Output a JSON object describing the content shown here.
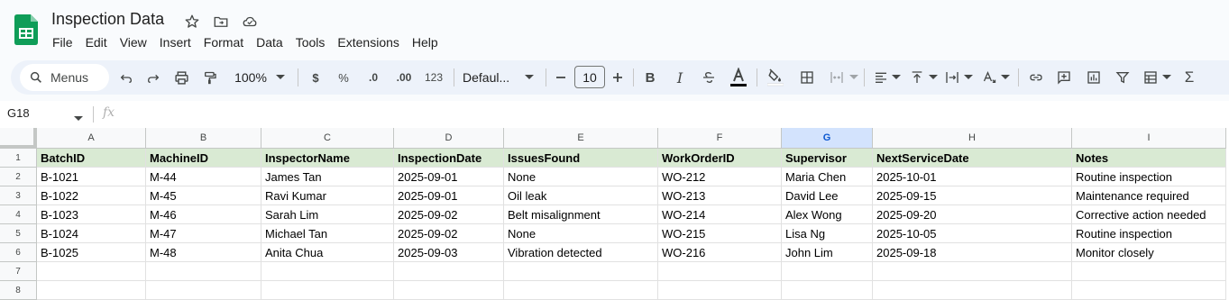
{
  "app": {
    "title": "Inspection Data",
    "menus": [
      "File",
      "Edit",
      "View",
      "Insert",
      "Format",
      "Data",
      "Tools",
      "Extensions",
      "Help"
    ]
  },
  "toolbar": {
    "search_label": "Menus",
    "zoom": "100%",
    "currency": "$",
    "percent": "%",
    "dec_decrease": ".0",
    "dec_increase": ".00",
    "number_format": "123",
    "font": "Defaul...",
    "font_size": "10",
    "accent": "#0b57d0"
  },
  "formula_bar": {
    "name_box": "G18",
    "fx": "fx",
    "value": ""
  },
  "sheet": {
    "columns": [
      "A",
      "B",
      "C",
      "D",
      "E",
      "F",
      "G",
      "H",
      "I"
    ],
    "selected_column": "G",
    "row_numbers": [
      "1",
      "2",
      "3",
      "4",
      "5",
      "6",
      "7",
      "8"
    ],
    "rows": [
      [
        "BatchID",
        "MachineID",
        "InspectorName",
        "InspectionDate",
        "IssuesFound",
        "WorkOrderID",
        "Supervisor",
        "NextServiceDate",
        "Notes"
      ],
      [
        "B-1021",
        "M-44",
        "James Tan",
        "2025-09-01",
        "None",
        "WO-212",
        "Maria Chen",
        "2025-10-01",
        "Routine inspection"
      ],
      [
        "B-1022",
        "M-45",
        "Ravi Kumar",
        "2025-09-01",
        "Oil leak",
        "WO-213",
        "David Lee",
        "2025-09-15",
        "Maintenance required"
      ],
      [
        "B-1023",
        "M-46",
        "Sarah Lim",
        "2025-09-02",
        "Belt misalignment",
        "WO-214",
        "Alex Wong",
        "2025-09-20",
        "Corrective action needed"
      ],
      [
        "B-1024",
        "M-47",
        "Michael Tan",
        "2025-09-02",
        "None",
        "WO-215",
        "Lisa Ng",
        "2025-10-05",
        "Routine inspection"
      ],
      [
        "B-1025",
        "M-48",
        "Anita Chua",
        "2025-09-03",
        "Vibration detected",
        "WO-216",
        "John Lim",
        "2025-09-18",
        "Monitor closely"
      ],
      [
        "",
        "",
        "",
        "",
        "",
        "",
        "",
        "",
        ""
      ],
      [
        "",
        "",
        "",
        "",
        "",
        "",
        "",
        "",
        ""
      ]
    ],
    "header_fill": "#d9ead3"
  }
}
